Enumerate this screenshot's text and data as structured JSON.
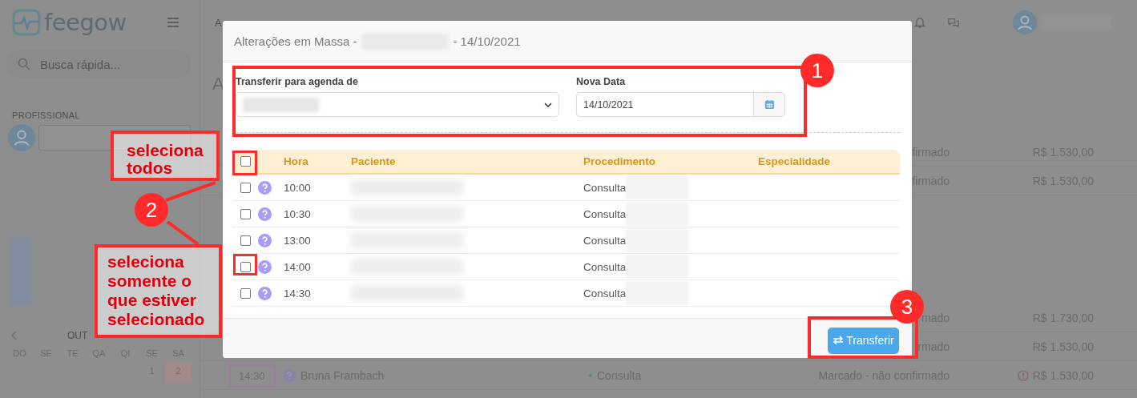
{
  "app": {
    "logo": "feegow",
    "search": {
      "placeholder": "Busca rápida..."
    },
    "sidebar_section": "PROFISSIONAL",
    "calendar": {
      "month": "OUT",
      "weekdays": [
        "DO",
        "SE",
        "TE",
        "QA",
        "QI",
        "SE",
        "SA"
      ],
      "days": [
        {
          "label": "1",
          "highlighted": false
        },
        {
          "label": "2",
          "highlighted": true
        }
      ]
    },
    "nav_label": "A",
    "page_title": "A",
    "appointments": [
      {
        "status": "firmado",
        "price": "R$ 1.530,00",
        "warning": false
      },
      {
        "status": "firmado",
        "price": "R$ 1.530,00",
        "warning": false
      },
      {
        "status": "mado",
        "price": "R$ 1.730,00",
        "warning": false
      },
      {
        "status": "rmado",
        "price": "R$ 1.530,00",
        "warning": false
      },
      {
        "time": "14:30",
        "patient": "Bruna Frambach",
        "procedure": "Consulta",
        "status": "Marcado - não confirmado",
        "price": "R$ 1.530,00",
        "warning": true
      }
    ]
  },
  "modal": {
    "title": "Alterações em Massa -",
    "title_date": "- 14/10/2021",
    "form": {
      "agenda_label": "Transferir para agenda de",
      "date_label": "Nova Data",
      "date_value": "14/10/2021"
    },
    "table": {
      "select_all": {
        "checked": false
      },
      "columns": [
        "Hora",
        "Paciente",
        "Procedimento",
        "Especialidade"
      ],
      "rows": [
        {
          "checked": false,
          "time": "10:00",
          "procedure": "Consulta"
        },
        {
          "checked": false,
          "time": "10:30",
          "procedure": "Consulta"
        },
        {
          "checked": false,
          "time": "13:00",
          "procedure": "Consulta"
        },
        {
          "checked": false,
          "time": "14:00",
          "procedure": "Consulta"
        },
        {
          "checked": false,
          "time": "14:30",
          "procedure": "Consulta"
        }
      ]
    },
    "submit": "Transferir"
  },
  "annotations": [
    {
      "number": "1"
    },
    {
      "number": "2",
      "notes": [
        "seleciona todos",
        "seleciona somente o que estiver selecionado"
      ]
    },
    {
      "number": "3"
    }
  ]
}
